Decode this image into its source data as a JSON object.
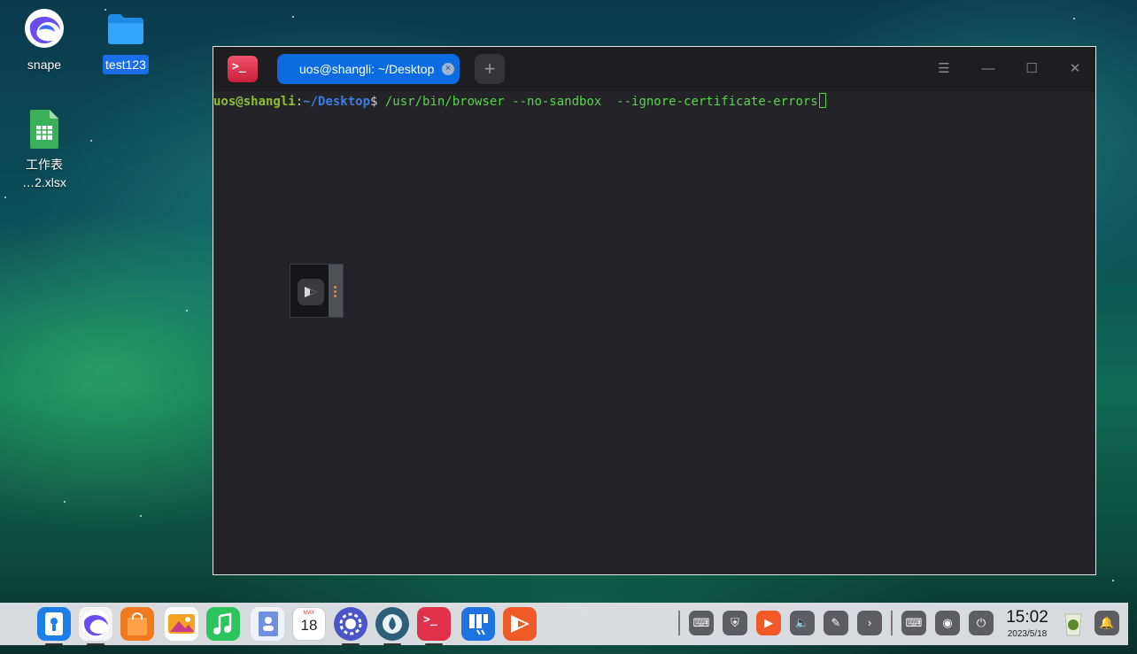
{
  "desktop": {
    "icons": [
      {
        "name": "snape",
        "selected": false
      },
      {
        "name": "test123",
        "selected": true
      },
      {
        "name_line1": "工作表",
        "name_line2": "…2.xlsx",
        "selected": false
      }
    ]
  },
  "terminal": {
    "tab_title": "uos@shangli: ~/Desktop",
    "tab_close": "×",
    "new_tab": "+",
    "prompt_user": "uos@shangli",
    "prompt_sep": ":",
    "prompt_path": "~/Desktop",
    "prompt_symbol": "$ ",
    "command": "/usr/bin/browser --no-sandbox  --ignore-certificate-errors",
    "controls": {
      "menu": "☰",
      "minimize": "—",
      "maximize": "☐",
      "close": "✕"
    }
  },
  "dock": {
    "apps": [
      {
        "icon": "launcher-icon",
        "color": "#1c7fe8",
        "running": true
      },
      {
        "icon": "browser-icon",
        "color": "#6b5ff0",
        "running": true
      },
      {
        "icon": "app-store-icon",
        "color": "#f07a20",
        "running": false
      },
      {
        "icon": "photos-icon",
        "color": "#f6a123",
        "running": false
      },
      {
        "icon": "music-icon",
        "color": "#2cc45c",
        "running": false
      },
      {
        "icon": "contacts-icon",
        "color": "#6f8fe0",
        "running": false
      },
      {
        "icon": "calendar-icon",
        "color": "#ffffff",
        "running": false
      },
      {
        "icon": "settings-icon",
        "color": "#4a55c8",
        "running": true
      },
      {
        "icon": "downloader-icon",
        "color": "#2d5f7a",
        "running": true
      },
      {
        "icon": "terminal-icon",
        "color": "#e0304a",
        "running": true
      },
      {
        "icon": "notes-icon",
        "color": "#1d73e0",
        "running": false
      },
      {
        "icon": "screen-recorder-icon",
        "color": "#f05a28",
        "running": false
      }
    ],
    "calendar_month": "MAY",
    "calendar_day": "18",
    "clock_time": "15:02",
    "clock_date": "2023/5/18"
  }
}
